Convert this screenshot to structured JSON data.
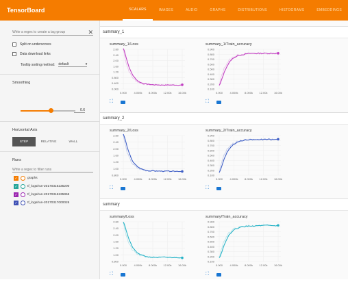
{
  "app": {
    "title": "TensorBoard"
  },
  "tabs": [
    {
      "label": "SCALARS",
      "active": true
    },
    {
      "label": "IMAGES"
    },
    {
      "label": "AUDIO"
    },
    {
      "label": "GRAPHS"
    },
    {
      "label": "DISTRIBUTIONS"
    },
    {
      "label": "HISTOGRAMS"
    },
    {
      "label": "EMBEDDINGS"
    }
  ],
  "sidebar": {
    "tag_regex_placeholder": "Write a regex to create a tag group",
    "split_underscores": "Split on underscores",
    "data_download": "Data download links",
    "tooltip_label": "Tooltip sorting method:",
    "tooltip_value": "default",
    "smoothing_label": "Smoothing",
    "smoothing_value": "0.6",
    "smoothing_fraction": 0.6,
    "horizontal_axis_label": "Horizontal Axis",
    "axis_options": [
      "STEP",
      "RELATIVE",
      "WALL"
    ],
    "runs_label": "Runs",
    "runs_placeholder": "Write a regex to filter runs",
    "runs": [
      {
        "name": "graphs",
        "checked": true,
        "color": "#f57c00"
      },
      {
        "name": "tf_logs/run-20170316235200",
        "checked": true,
        "color": "#26a69a"
      },
      {
        "name": "tf_logs/run-20170316235956",
        "checked": true,
        "color": "#9c27b0"
      },
      {
        "name": "tf_logs/run-20170317000026",
        "checked": true,
        "color": "#3f51b5"
      }
    ]
  },
  "x_ticks": [
    "0.000",
    "4.000k",
    "8.000k",
    "12.00k",
    "16.00k"
  ],
  "groups": [
    {
      "title": "summary_1",
      "color": "#c23fc2",
      "loss": {
        "title": "summary_1/Loss",
        "yticks": [
          "2.80",
          "2.40",
          "2.00",
          "1.60",
          "1.20",
          "0.800",
          "0.400",
          "0.000"
        ]
      },
      "acc": {
        "title": "summary_1/Train_accuracy",
        "yticks": [
          "0.900",
          "0.800",
          "0.700",
          "0.600",
          "0.500",
          "0.400",
          "0.300",
          "0.200",
          "0.100"
        ]
      }
    },
    {
      "title": "summary_2",
      "color": "#3f5fc6",
      "loss": {
        "title": "summary_2/Loss",
        "yticks": [
          "2.80",
          "2.40",
          "2.00",
          "1.60",
          "1.20",
          "1.00",
          "0.800"
        ]
      },
      "acc": {
        "title": "summary_2/Train_accuracy",
        "yticks": [
          "0.900",
          "0.800",
          "0.700",
          "0.600",
          "0.500",
          "0.400",
          "0.300",
          "0.200",
          "0.100"
        ]
      }
    },
    {
      "title": "summary",
      "color": "#26b3c7",
      "loss": {
        "title": "summary/Loss",
        "yticks": [
          "2.80",
          "2.40",
          "2.00",
          "1.60",
          "1.20",
          "1.00",
          "0.800"
        ]
      },
      "acc": {
        "title": "summary/Train_accuracy",
        "yticks": [
          "0.900",
          "0.800",
          "0.700",
          "0.600",
          "0.500",
          "0.400",
          "0.300",
          "0.200",
          "0.100"
        ]
      }
    }
  ]
}
